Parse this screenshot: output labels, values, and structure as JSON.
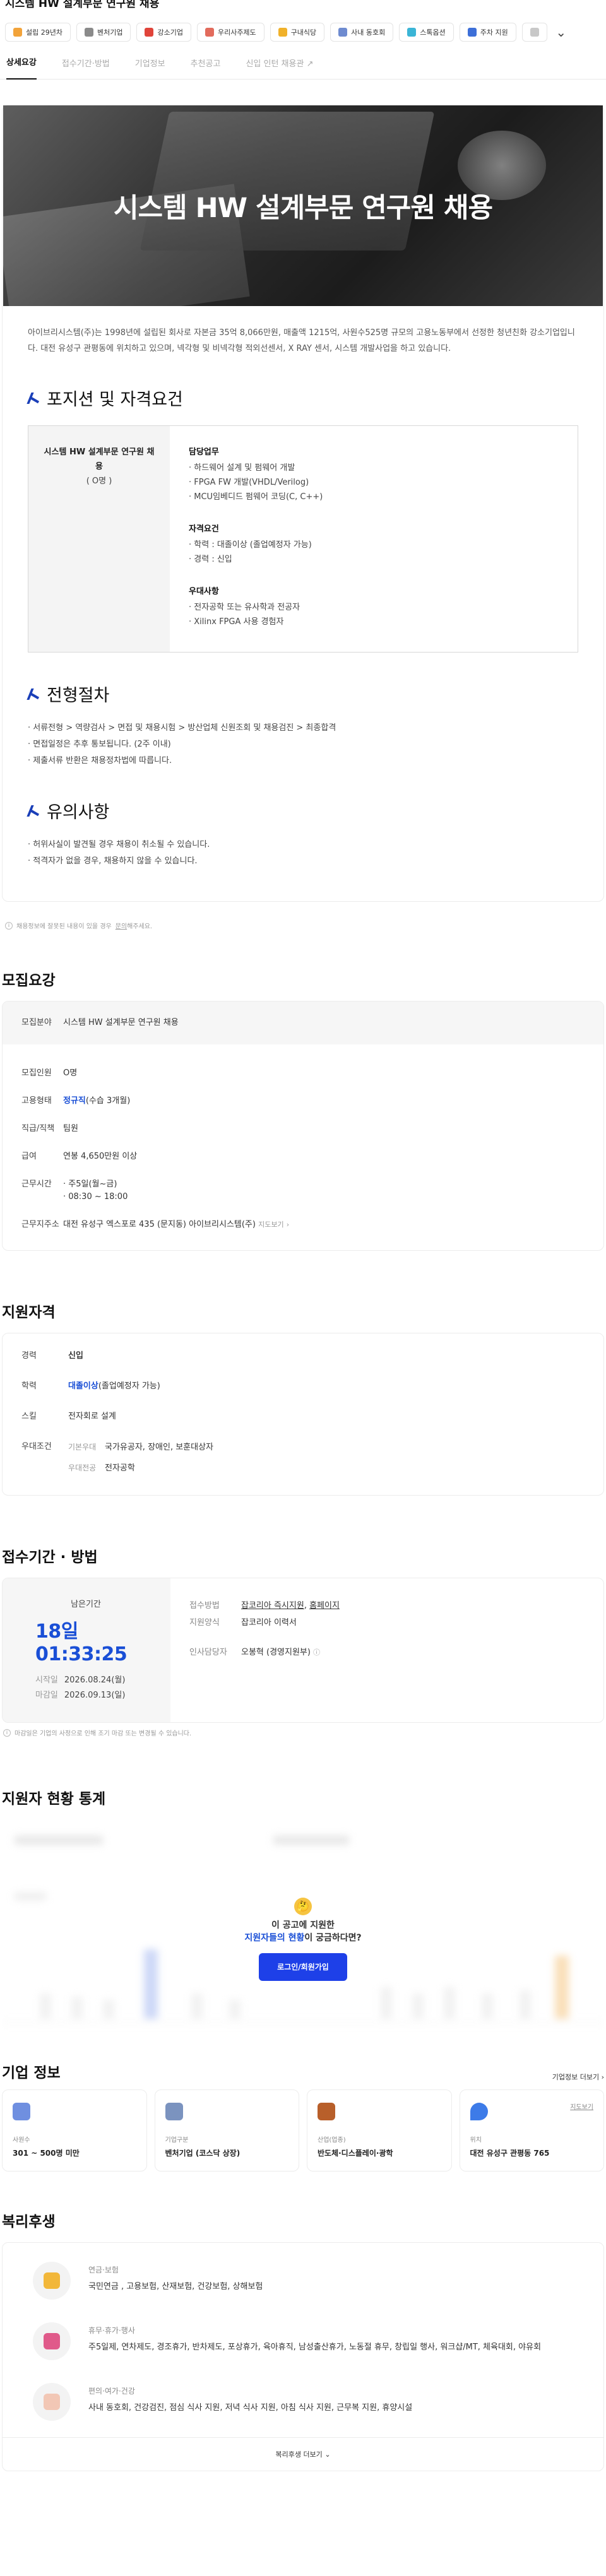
{
  "header": {
    "title": "시스템 HW 설계부문 연구원 채용"
  },
  "tags": [
    {
      "label": "설립 29년차",
      "color": "#f2a33a"
    },
    {
      "label": "벤처기업",
      "color": "#8a8a8a"
    },
    {
      "label": "강소기업",
      "color": "#e0443a"
    },
    {
      "label": "우리사주제도",
      "color": "#e26b5c"
    },
    {
      "label": "구내식당",
      "color": "#f0b12a"
    },
    {
      "label": "사내 동호회",
      "color": "#6e8bd0"
    },
    {
      "label": "스톡옵션",
      "color": "#3bb5d6"
    },
    {
      "label": "주차 지원",
      "color": "#3d6fd8"
    },
    {
      "label": "",
      "color": "#c8c8c8"
    }
  ],
  "tabs": [
    "상세요강",
    "접수기간·방법",
    "기업정보",
    "추천공고",
    "신입 인턴 채용관"
  ],
  "hero": {
    "title": "시스템 HW 설계부문 연구원 채용"
  },
  "intro": "아이브리시스템(주)는 1998년에 설립된 회사로 자본금 35억 8,066만원, 매출액 1215억, 사원수525명 규모의 고용노동부에서 선정한 청년친화 강소기업입니다. 대전 유성구 관평동에 위치하고 있으며, 넥각형 및 비넥각형 적외선센서, X RAY 센서, 시스템 개발사업을 하고 있습니다.",
  "position": {
    "heading": "포지션 및 자격요건",
    "name": "시스템 HW 설계부문 연구원 채용",
    "count": "( O명 )",
    "groups": [
      {
        "title": "담당업무",
        "items": [
          "· 하드웨어 설계 및 펌웨어 개발",
          "· FPGA FW 개발(VHDL/Verilog)",
          "· MCU임베디드 펌웨어 코딩(C, C++)"
        ]
      },
      {
        "title": "자격요건",
        "items": [
          "· 학력 : 대졸이상 (졸업예정자 가능)",
          "· 경력 : 신입"
        ]
      },
      {
        "title": "우대사항",
        "items": [
          "· 전자공학 또는 유사학과 전공자",
          "· Xilinx FPGA 사용 경험자"
        ]
      }
    ]
  },
  "process": {
    "heading": "전형절차",
    "items": [
      "· 서류전형 > 역량검사 > 면접 및 채용시험 > 방산업체 신원조회 및 채용검진 > 최종합격",
      "· 면접일정은 추후 통보됩니다. (2주 이내)",
      "· 제출서류 반환은 채용정차법에 따릅니다."
    ]
  },
  "notice": {
    "heading": "유의사항",
    "items": [
      "· 허위사실이 발견될 경우 채용이 취소될 수 있습니다.",
      "· 적격자가 없을 경우, 채용하지 않을 수 있습니다."
    ]
  },
  "footnote": {
    "text": "채용정보에 잘못된 내용이 있을 경우",
    "link": "문의",
    "tail": "해주세요."
  },
  "recruit": {
    "heading": "모집요강",
    "field_k": "모집분야",
    "field_v": "시스템 HW 설계부문 연구원 채용",
    "count_k": "모집인원",
    "count_v": "O명",
    "type_k": "고용형태",
    "type_v": "정규직",
    "type_extra": "(수습 3개월)",
    "rank_k": "직급/직책",
    "rank_v": "팀원",
    "salary_k": "급여",
    "salary_v": "연봉 4,650만원 이상",
    "hours_k": "근무시간",
    "hours_v1": "· 주5일(월~금)",
    "hours_v2": "· 08:30 ~ 18:00",
    "addr_k": "근무지주소",
    "addr_v": "대전 유성구 엑스포로 435 (문지동) 아이브리시스템(주)",
    "addr_link": "지도보기"
  },
  "qualify": {
    "heading": "지원자격",
    "career_k": "경력",
    "career_v": "신입",
    "edu_k": "학력",
    "edu_v": "대졸이상",
    "edu_extra": "(졸업예정자 가능)",
    "skill_k": "스킬",
    "skill_v": "전자회로 설계",
    "pref_k": "우대조건",
    "pref_sub1": "기본우대",
    "pref_v1": "국가유공자, 장애인, 보훈대상자",
    "pref_sub2": "우대전공",
    "pref_v2": "전자공학"
  },
  "period": {
    "heading": "접수기간 · 방법",
    "remain_label": "남은기간",
    "countdown": "18일 01:33:25",
    "start_k": "시작일",
    "start_v": "2026.08.24(월)",
    "end_k": "마감일",
    "end_v": "2026.09.13(일)",
    "method_k": "접수방법",
    "method_v1": "잡코리아 즉시지원",
    "method_v2": "홈페이지",
    "form_k": "지원양식",
    "form_v": "잡코리아 이력서",
    "hr_k": "인사담당자",
    "hr_v": "오봉혁 (경영지원부)",
    "note": "마감일은 기업의 사정으로 인해 조기 마감 또는 변경될 수 있습니다."
  },
  "stats": {
    "heading": "지원자 현황 통계",
    "line1": "이 공고에 지원한",
    "line2_blue": "지원자들의 현황",
    "line2_tail": "이 궁금하다면?",
    "button": "로그인/회원가입"
  },
  "company": {
    "heading": "기업 정보",
    "more": "기업정보 더보기 ›",
    "cards": [
      {
        "k": "사원수",
        "v": "301 ~ 500명 미만",
        "color": "#6f8fe0"
      },
      {
        "k": "기업구분",
        "v": "벤처기업 (코스닥 상장)",
        "color": "#7b93bf"
      },
      {
        "k": "산업(업종)",
        "v": "반도체·디스플레이·광학",
        "color": "#b85f2a"
      },
      {
        "k": "위치",
        "v": "대전 유성구 관평동 765",
        "color": "#3d7be8",
        "link": "지도보기"
      }
    ]
  },
  "welfare": {
    "heading": "복리후생",
    "items": [
      {
        "title": "연금·보험",
        "value": "국민연금 , 고용보험, 산재보험, 건강보험, 상해보험",
        "color": "#f2b73a"
      },
      {
        "title": "휴무·휴가·행사",
        "value": "주5일제, 연차제도, 경조휴가, 반차제도, 포상휴가, 육아휴직, 남성출산휴가, 노동절 휴무, 창립일 행사, 워크샵/MT, 체육대회, 야유회",
        "color": "#e05a8a"
      },
      {
        "title": "편의·여가·건강",
        "value": "사내 동호회, 건강검진, 점심 식사 지원, 저녁 식사 지원, 아침 식사 지원, 근무복 지원, 휴양시설",
        "color": "#f2c7b5"
      }
    ],
    "more": "복리후생 더보기"
  }
}
